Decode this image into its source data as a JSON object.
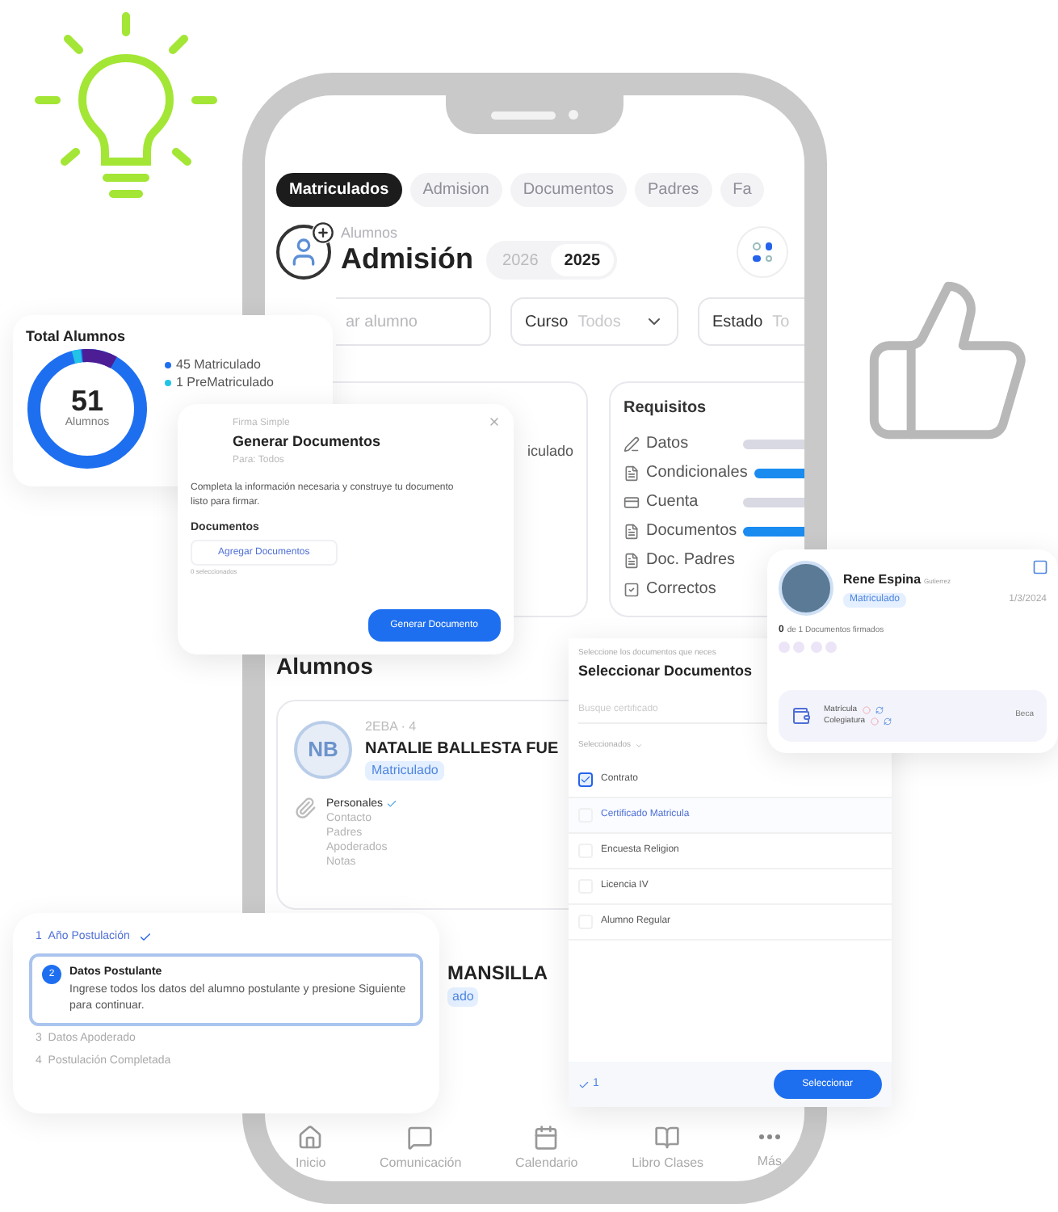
{
  "phone": {
    "tabs": [
      {
        "label": "Matriculados",
        "selected": true
      },
      {
        "label": "Admision",
        "selected": false
      },
      {
        "label": "Documentos",
        "selected": false
      },
      {
        "label": "Padres",
        "selected": false
      },
      {
        "label": "Fa",
        "selected": false
      }
    ],
    "header": {
      "caption": "Alumnos",
      "title": "Admisión",
      "years": [
        {
          "label": "2026",
          "selected": false
        },
        {
          "label": "2025",
          "selected": true
        }
      ]
    },
    "filters": {
      "search": {
        "placeholder": "ar alumno"
      },
      "selects": [
        {
          "label": "Curso",
          "value": "Todos"
        },
        {
          "label": "Estado",
          "value": "To"
        }
      ]
    },
    "summary_card": {
      "text": "iculado"
    },
    "requisitos": {
      "title": "Requisitos",
      "items": [
        {
          "label": "Datos",
          "color": "#d9d9e3"
        },
        {
          "label": "Condicionales",
          "color": "#1a8cf0"
        },
        {
          "label": "Cuenta",
          "color": "#d9d9e3"
        },
        {
          "label": "Documentos",
          "color": "#1a8cf0"
        },
        {
          "label": "Doc. Padres"
        },
        {
          "label": "Correctos"
        }
      ]
    },
    "alumnos_heading": "Alumnos",
    "students": [
      {
        "initials": "NB",
        "course": "2EBA · 4",
        "name": "NATALIE BALLESTA FUE",
        "status": "Matriculado",
        "sections": [
          {
            "label": "Personales",
            "done": true
          },
          {
            "label": "Contacto",
            "done": false
          },
          {
            "label": "Padres",
            "done": false
          },
          {
            "label": "Apoderados",
            "done": false
          },
          {
            "label": "Notas",
            "done": false
          }
        ]
      },
      {
        "name": "MANSILLA",
        "status": "ado"
      }
    ],
    "nav": [
      {
        "label": "Inicio"
      },
      {
        "label": "Comunicación"
      },
      {
        "label": "Calendario"
      },
      {
        "label": "Libro Clases"
      },
      {
        "label": "Más"
      }
    ]
  },
  "total_card": {
    "title": "Total Alumnos",
    "total": "51",
    "caption": "Alumnos",
    "legend": [
      {
        "label": "45 Matriculado",
        "color": "#1e6ff0"
      },
      {
        "label": "1 PreMatriculado",
        "color": "#22c3e6"
      }
    ]
  },
  "generate_dialog": {
    "caption": "Firma Simple",
    "title": "Generar Documentos",
    "subtitle": "Para: Todos",
    "description": "Completa la información necesaria y construye tu documento listo para firmar.",
    "section": "Documentos",
    "add_button": "Agregar Documentos",
    "selected_count": "0 seleccionados",
    "submit_button": "Generar Documento"
  },
  "select_documents": {
    "caption": "Seleccione los documentos que neces",
    "title": "Seleccionar Documentos",
    "search": {
      "placeholder": "Busque certificado"
    },
    "group": "Seleccionados",
    "items": [
      {
        "label": "Contrato",
        "checked": true,
        "highlighted": false
      },
      {
        "label": "Certificado Matricula",
        "checked": false,
        "highlighted": true
      },
      {
        "label": "Encuesta Religion",
        "checked": false,
        "highlighted": false
      },
      {
        "label": "Licencia IV",
        "checked": false,
        "highlighted": false
      },
      {
        "label": "Alumno Regular",
        "checked": false,
        "highlighted": false
      }
    ],
    "count": "1",
    "button": "Seleccionar"
  },
  "student_card": {
    "name": "Rene Espina",
    "surname": "Gutierrez",
    "status": "Matriculado",
    "date": "1/3/2024",
    "documents_count": "0",
    "documents_text": "de 1 Documentos firmados",
    "payments": [
      {
        "label": "Matrícula"
      },
      {
        "label": "Colegiatura"
      }
    ],
    "scholarship": "Beca"
  },
  "stepper": {
    "steps": [
      {
        "number": "1",
        "title": "Año Postulación",
        "done": true,
        "selected": false
      },
      {
        "number": "2",
        "title": "Datos Postulante",
        "description": "Ingrese todos los datos del alumno postulante y presione Siguiente para continuar.",
        "selected": true
      },
      {
        "number": "3",
        "title": "Datos Apoderado",
        "done": false,
        "selected": false
      },
      {
        "number": "4",
        "title": "Postulación Completada",
        "done": false,
        "selected": false
      }
    ]
  }
}
